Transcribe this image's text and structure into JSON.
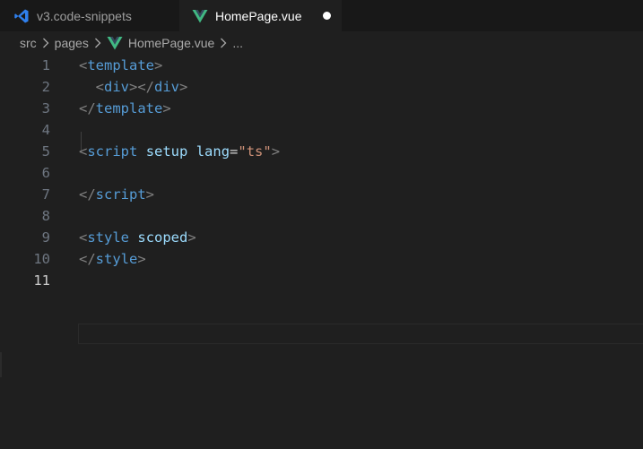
{
  "tabs": [
    {
      "label": "v3.code-snippets",
      "icon": "vscode-icon",
      "active": false
    },
    {
      "label": "HomePage.vue",
      "icon": "vue-icon",
      "active": true,
      "modified": true
    }
  ],
  "breadcrumb": {
    "items": [
      "src",
      "pages",
      "HomePage.vue",
      "..."
    ],
    "separator": "chevron-right-icon"
  },
  "editor": {
    "current_line": 11,
    "lines": [
      {
        "number": "1",
        "tokens": [
          {
            "t": "<",
            "c": "punc"
          },
          {
            "t": "template",
            "c": "tag"
          },
          {
            "t": ">",
            "c": "punc"
          }
        ]
      },
      {
        "number": "2",
        "tokens": [
          {
            "t": "  ",
            "c": "eq"
          },
          {
            "t": "<",
            "c": "punc"
          },
          {
            "t": "div",
            "c": "tag"
          },
          {
            "t": "></",
            "c": "punc"
          },
          {
            "t": "div",
            "c": "tag"
          },
          {
            "t": ">",
            "c": "punc"
          }
        ]
      },
      {
        "number": "3",
        "tokens": [
          {
            "t": "</",
            "c": "punc"
          },
          {
            "t": "template",
            "c": "tag"
          },
          {
            "t": ">",
            "c": "punc"
          }
        ]
      },
      {
        "number": "4",
        "tokens": []
      },
      {
        "number": "5",
        "tokens": [
          {
            "t": "<",
            "c": "punc"
          },
          {
            "t": "script",
            "c": "tag"
          },
          {
            "t": " ",
            "c": "eq"
          },
          {
            "t": "setup",
            "c": "attr"
          },
          {
            "t": " ",
            "c": "eq"
          },
          {
            "t": "lang",
            "c": "attr"
          },
          {
            "t": "=",
            "c": "eq"
          },
          {
            "t": "\"ts\"",
            "c": "str"
          },
          {
            "t": ">",
            "c": "punc"
          }
        ]
      },
      {
        "number": "6",
        "tokens": []
      },
      {
        "number": "7",
        "tokens": [
          {
            "t": "</",
            "c": "punc"
          },
          {
            "t": "script",
            "c": "tag"
          },
          {
            "t": ">",
            "c": "punc"
          }
        ]
      },
      {
        "number": "8",
        "tokens": []
      },
      {
        "number": "9",
        "tokens": [
          {
            "t": "<",
            "c": "punc"
          },
          {
            "t": "style",
            "c": "tag"
          },
          {
            "t": " ",
            "c": "eq"
          },
          {
            "t": "scoped",
            "c": "attr"
          },
          {
            "t": ">",
            "c": "punc"
          }
        ]
      },
      {
        "number": "10",
        "tokens": [
          {
            "t": "</",
            "c": "punc"
          },
          {
            "t": "style",
            "c": "tag"
          },
          {
            "t": ">",
            "c": "punc"
          }
        ]
      },
      {
        "number": "11",
        "tokens": []
      }
    ]
  },
  "colors": {
    "tag": "#569cd6",
    "attribute": "#9cdcfe",
    "string": "#ce9178",
    "punctuation": "#808080",
    "vscode_icon": "#2f80ed",
    "vue_icon": "#41b883"
  }
}
